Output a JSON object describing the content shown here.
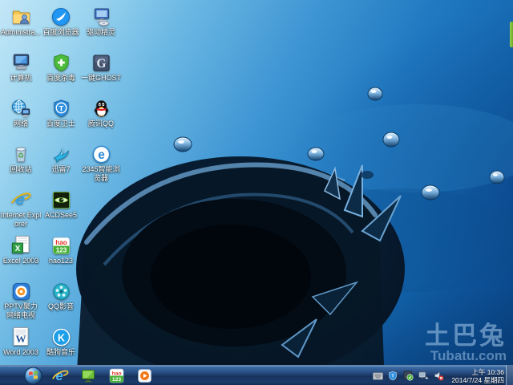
{
  "desktop_icons": [
    {
      "id": "administrator",
      "label": "Administra..."
    },
    {
      "id": "baidu-browser",
      "label": "百度浏览器"
    },
    {
      "id": "driver-genius",
      "label": "驱动精灵"
    },
    {
      "id": "computer",
      "label": "计算机"
    },
    {
      "id": "baidu-antivirus",
      "label": "百度杀毒"
    },
    {
      "id": "one-key-ghost",
      "label": "一键GHOST"
    },
    {
      "id": "network",
      "label": "网络"
    },
    {
      "id": "baidu-weishi",
      "label": "百度卫士"
    },
    {
      "id": "tencent-qq",
      "label": "腾讯QQ"
    },
    {
      "id": "recycle-bin",
      "label": "回收站"
    },
    {
      "id": "xunlei7",
      "label": "迅雷7"
    },
    {
      "id": "browser-2345",
      "label": "2345智能浏览器"
    },
    {
      "id": "internet-explorer",
      "label": "Internet Explorer"
    },
    {
      "id": "acdsee5",
      "label": "ACDSee5"
    },
    {
      "id": "excel-2003",
      "label": "Excel 2003"
    },
    {
      "id": "hao123",
      "label": "hao123"
    },
    {
      "id": "pptv",
      "label": "PPTV聚力 网络电视"
    },
    {
      "id": "qq-player",
      "label": "QQ影音"
    },
    {
      "id": "word-2003",
      "label": "Word 2003"
    },
    {
      "id": "kugou-music",
      "label": "酷狗音乐"
    }
  ],
  "glyphs": {
    "ghost": "G",
    "weishi": "T",
    "e2345": "e",
    "ie": "e",
    "excel": "X",
    "word": "W",
    "kugou": "K",
    "hao_top": "hao",
    "hao_bottom": "123",
    "recycle": "♻"
  },
  "taskbar": {
    "pinned": [
      "start-button",
      "internet-explorer",
      "green-display",
      "hao123",
      "media-player"
    ]
  },
  "tray": {
    "icons": [
      "input-keyboard",
      "baidu-weishi-shield",
      "antivirus-check",
      "network-status",
      "volume-muted"
    ],
    "clock_time": "上午 10:36",
    "clock_date": "2014/7/24 星期四"
  },
  "watermark": {
    "title": "土巴兔",
    "subtitle": "Tubatu.com"
  },
  "colors": {
    "wallpaper_light": "#c3e7f7",
    "wallpaper_deep": "#0a4076",
    "taskbar": "#17335c",
    "watermark": "rgba(168,203,235,0.55)",
    "dock_handle_green": "#7db93a"
  }
}
